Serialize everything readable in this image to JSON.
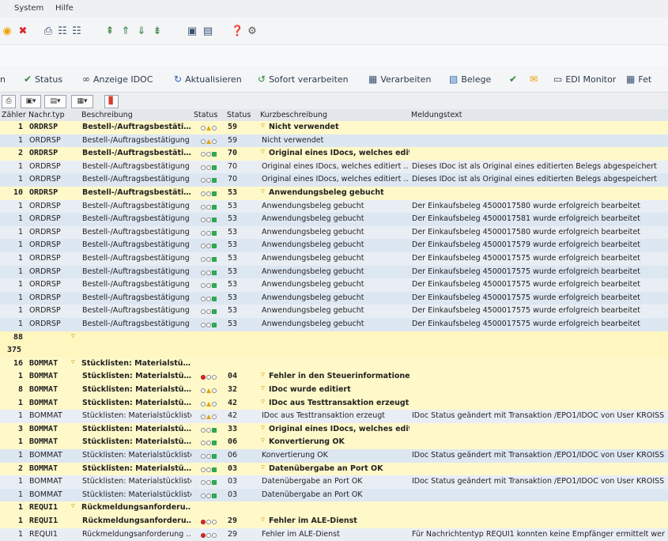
{
  "menu": {
    "system": "System",
    "help": "Hilfe"
  },
  "app_toolbar": [
    {
      "label": "n",
      "icon": ""
    },
    {
      "label": "Status",
      "icon": "status-icon"
    },
    {
      "label": "Anzeige IDOC",
      "icon": "glasses-icon"
    },
    {
      "label": "Aktualisieren",
      "icon": "refresh-icon"
    },
    {
      "label": "Sofort verarbeiten",
      "icon": "process-icon"
    },
    {
      "label": "Verarbeiten",
      "icon": "process-icon"
    },
    {
      "label": "Belege",
      "icon": "documents-icon"
    },
    {
      "label": "",
      "icon": "check-icon"
    },
    {
      "label": "",
      "icon": "mail-icon"
    },
    {
      "label": "EDI Monitor",
      "icon": "monitor-icon"
    },
    {
      "label": "Fet",
      "icon": "table-icon"
    }
  ],
  "columns": [
    "Zähler",
    "Nachr.typ",
    "Beschreibung",
    "Status",
    "Status",
    "Kurzbeschreibung",
    "Meldungstext"
  ],
  "rows": [
    {
      "kind": "sum",
      "count": "1",
      "msgtype": "ORDRSP",
      "desc": "Bestell-/Auftragsbestäti…",
      "lights": "yellow",
      "status": "59",
      "short": "Nicht verwendet",
      "msg": ""
    },
    {
      "kind": "det",
      "count": "1",
      "msgtype": "ORDRSP",
      "desc": "Bestell-/Auftragsbestätigung",
      "lights": "yellow",
      "status": "59",
      "short": "Nicht verwendet",
      "msg": ""
    },
    {
      "kind": "sum",
      "count": "2",
      "msgtype": "ORDRSP",
      "desc": "Bestell-/Auftragsbestäti…",
      "lights": "green",
      "status": "70",
      "short": "Original eines IDocs, welches editi…",
      "msg": ""
    },
    {
      "kind": "det",
      "count": "1",
      "msgtype": "ORDRSP",
      "desc": "Bestell-/Auftragsbestätigung",
      "lights": "green",
      "status": "70",
      "short": "Original eines IDocs, welches editiert …",
      "msg": "Dieses IDoc ist als Original eines editierten Belegs abgespeichert"
    },
    {
      "kind": "det",
      "count": "1",
      "msgtype": "ORDRSP",
      "desc": "Bestell-/Auftragsbestätigung",
      "lights": "green",
      "status": "70",
      "short": "Original eines IDocs, welches editiert …",
      "msg": "Dieses IDoc ist als Original eines editierten Belegs abgespeichert"
    },
    {
      "kind": "sum",
      "count": "10",
      "msgtype": "ORDRSP",
      "desc": "Bestell-/Auftragsbestäti…",
      "lights": "green",
      "status": "53",
      "short": "Anwendungsbeleg gebucht",
      "msg": ""
    },
    {
      "kind": "det",
      "count": "1",
      "msgtype": "ORDRSP",
      "desc": "Bestell-/Auftragsbestätigung",
      "lights": "green",
      "status": "53",
      "short": "Anwendungsbeleg gebucht",
      "msg": "Der Einkaufsbeleg 4500017580 wurde erfolgreich bearbeitet"
    },
    {
      "kind": "det",
      "count": "1",
      "msgtype": "ORDRSP",
      "desc": "Bestell-/Auftragsbestätigung",
      "lights": "green",
      "status": "53",
      "short": "Anwendungsbeleg gebucht",
      "msg": "Der Einkaufsbeleg 4500017581 wurde erfolgreich bearbeitet"
    },
    {
      "kind": "det",
      "count": "1",
      "msgtype": "ORDRSP",
      "desc": "Bestell-/Auftragsbestätigung",
      "lights": "green",
      "status": "53",
      "short": "Anwendungsbeleg gebucht",
      "msg": "Der Einkaufsbeleg 4500017580 wurde erfolgreich bearbeitet"
    },
    {
      "kind": "det",
      "count": "1",
      "msgtype": "ORDRSP",
      "desc": "Bestell-/Auftragsbestätigung",
      "lights": "green",
      "status": "53",
      "short": "Anwendungsbeleg gebucht",
      "msg": "Der Einkaufsbeleg 4500017579 wurde erfolgreich bearbeitet"
    },
    {
      "kind": "det",
      "count": "1",
      "msgtype": "ORDRSP",
      "desc": "Bestell-/Auftragsbestätigung",
      "lights": "green",
      "status": "53",
      "short": "Anwendungsbeleg gebucht",
      "msg": "Der Einkaufsbeleg 4500017575 wurde erfolgreich bearbeitet"
    },
    {
      "kind": "det",
      "count": "1",
      "msgtype": "ORDRSP",
      "desc": "Bestell-/Auftragsbestätigung",
      "lights": "green",
      "status": "53",
      "short": "Anwendungsbeleg gebucht",
      "msg": "Der Einkaufsbeleg 4500017575 wurde erfolgreich bearbeitet"
    },
    {
      "kind": "det",
      "count": "1",
      "msgtype": "ORDRSP",
      "desc": "Bestell-/Auftragsbestätigung",
      "lights": "green",
      "status": "53",
      "short": "Anwendungsbeleg gebucht",
      "msg": "Der Einkaufsbeleg 4500017575 wurde erfolgreich bearbeitet"
    },
    {
      "kind": "det",
      "count": "1",
      "msgtype": "ORDRSP",
      "desc": "Bestell-/Auftragsbestätigung",
      "lights": "green",
      "status": "53",
      "short": "Anwendungsbeleg gebucht",
      "msg": "Der Einkaufsbeleg 4500017575 wurde erfolgreich bearbeitet"
    },
    {
      "kind": "det",
      "count": "1",
      "msgtype": "ORDRSP",
      "desc": "Bestell-/Auftragsbestätigung",
      "lights": "green",
      "status": "53",
      "short": "Anwendungsbeleg gebucht",
      "msg": "Der Einkaufsbeleg 4500017575 wurde erfolgreich bearbeitet"
    },
    {
      "kind": "det",
      "count": "1",
      "msgtype": "ORDRSP",
      "desc": "Bestell-/Auftragsbestätigung",
      "lights": "green",
      "status": "53",
      "short": "Anwendungsbeleg gebucht",
      "msg": "Der Einkaufsbeleg 4500017575 wurde erfolgreich bearbeitet"
    },
    {
      "kind": "tot",
      "count": "88",
      "msgtype": "",
      "desc": "",
      "lights": "",
      "status": "",
      "short": "",
      "msg": ""
    },
    {
      "kind": "tot2",
      "count": "375",
      "msgtype": "",
      "desc": "",
      "lights": "",
      "status": "",
      "short": "",
      "msg": ""
    },
    {
      "kind": "sum",
      "count": "16",
      "msgtype": "BOMMAT",
      "desc": "Stücklisten: Materialstü…",
      "lights": "",
      "status": "",
      "short": "",
      "msg": "",
      "funnel_desc": true
    },
    {
      "kind": "sum",
      "count": "1",
      "msgtype": "BOMMAT",
      "desc": "Stücklisten: Materialstü…",
      "lights": "red",
      "status": "04",
      "short": "Fehler in den Steuerinformatione…",
      "msg": ""
    },
    {
      "kind": "sum",
      "count": "8",
      "msgtype": "BOMMAT",
      "desc": "Stücklisten: Materialstü…",
      "lights": "yellow",
      "status": "32",
      "short": "IDoc wurde editiert",
      "msg": ""
    },
    {
      "kind": "sum",
      "count": "1",
      "msgtype": "BOMMAT",
      "desc": "Stücklisten: Materialstü…",
      "lights": "yellow",
      "status": "42",
      "short": "IDoc aus Testtransaktion erzeugt",
      "msg": ""
    },
    {
      "kind": "det",
      "count": "1",
      "msgtype": "BOMMAT",
      "desc": "Stücklisten: Materialstückliste",
      "lights": "yellow",
      "status": "42",
      "short": "IDoc aus Testtransaktion erzeugt",
      "msg": "IDoc Status geändert mit Transaktion /EPO1/IDOC von User KROISS"
    },
    {
      "kind": "sum",
      "count": "3",
      "msgtype": "BOMMAT",
      "desc": "Stücklisten: Materialstü…",
      "lights": "green",
      "status": "33",
      "short": "Original eines IDocs, welches editi…",
      "msg": ""
    },
    {
      "kind": "sum",
      "count": "1",
      "msgtype": "BOMMAT",
      "desc": "Stücklisten: Materialstü…",
      "lights": "green",
      "status": "06",
      "short": "Konvertierung OK",
      "msg": ""
    },
    {
      "kind": "det",
      "count": "1",
      "msgtype": "BOMMAT",
      "desc": "Stücklisten: Materialstückliste",
      "lights": "green",
      "status": "06",
      "short": "Konvertierung OK",
      "msg": "IDoc Status geändert mit Transaktion /EPO1/IDOC von User KROISS"
    },
    {
      "kind": "sum",
      "count": "2",
      "msgtype": "BOMMAT",
      "desc": "Stücklisten: Materialstü…",
      "lights": "green",
      "status": "03",
      "short": "Datenübergabe an Port OK",
      "msg": ""
    },
    {
      "kind": "det",
      "count": "1",
      "msgtype": "BOMMAT",
      "desc": "Stücklisten: Materialstückliste",
      "lights": "green",
      "status": "03",
      "short": "Datenübergabe an Port OK",
      "msg": "IDoc Status geändert mit Transaktion /EPO1/IDOC von User KROISS"
    },
    {
      "kind": "det",
      "count": "1",
      "msgtype": "BOMMAT",
      "desc": "Stücklisten: Materialstückliste",
      "lights": "green",
      "status": "03",
      "short": "Datenübergabe an Port OK",
      "msg": ""
    },
    {
      "kind": "sum",
      "count": "1",
      "msgtype": "REQUI1",
      "desc": "Rückmeldungsanforderu…",
      "lights": "",
      "status": "",
      "short": "",
      "msg": "",
      "funnel_desc": true
    },
    {
      "kind": "sum",
      "count": "1",
      "msgtype": "REQUI1",
      "desc": "Rückmeldungsanforderu…",
      "lights": "red",
      "status": "29",
      "short": "Fehler im ALE-Dienst",
      "msg": ""
    },
    {
      "kind": "det",
      "count": "1",
      "msgtype": "REQUI1",
      "desc": "Rückmeldungsanforderung …",
      "lights": "red",
      "status": "29",
      "short": "Fehler im ALE-Dienst",
      "msg": "Für Nachrichtentyp REQUI1 konnten keine Empfänger ermittelt wer"
    }
  ]
}
